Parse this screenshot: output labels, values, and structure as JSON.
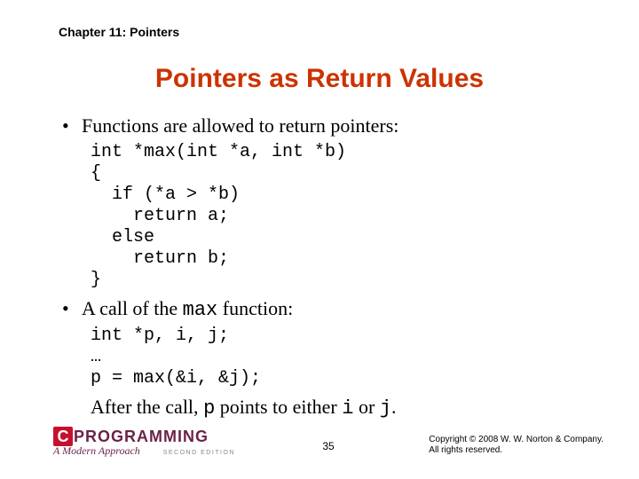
{
  "chapter": "Chapter 11: Pointers",
  "title": "Pointers as Return Values",
  "bullets": [
    "Functions are allowed to return pointers:",
    "A call of the "
  ],
  "bullet2_code": "max",
  "bullet2_tail": " function:",
  "code1": "int *max(int *a, int *b)\n{\n  if (*a > *b)\n    return a;\n  else\n    return b;\n}",
  "code2": "int *p, i, j;\n…\np = max(&i, &j);",
  "after_prefix": "After the call, ",
  "after_p": "p",
  "after_mid": " points to either ",
  "after_i": "i",
  "after_or": " or ",
  "after_j": "j",
  "after_dot": ".",
  "page_number": "35",
  "copyright_l1": "Copyright © 2008 W. W. Norton & Company.",
  "copyright_l2": "All rights reserved.",
  "logo": {
    "c": "C",
    "text": "PROGRAMMING",
    "sub": "A Modern Approach",
    "edition": "SECOND EDITION"
  }
}
